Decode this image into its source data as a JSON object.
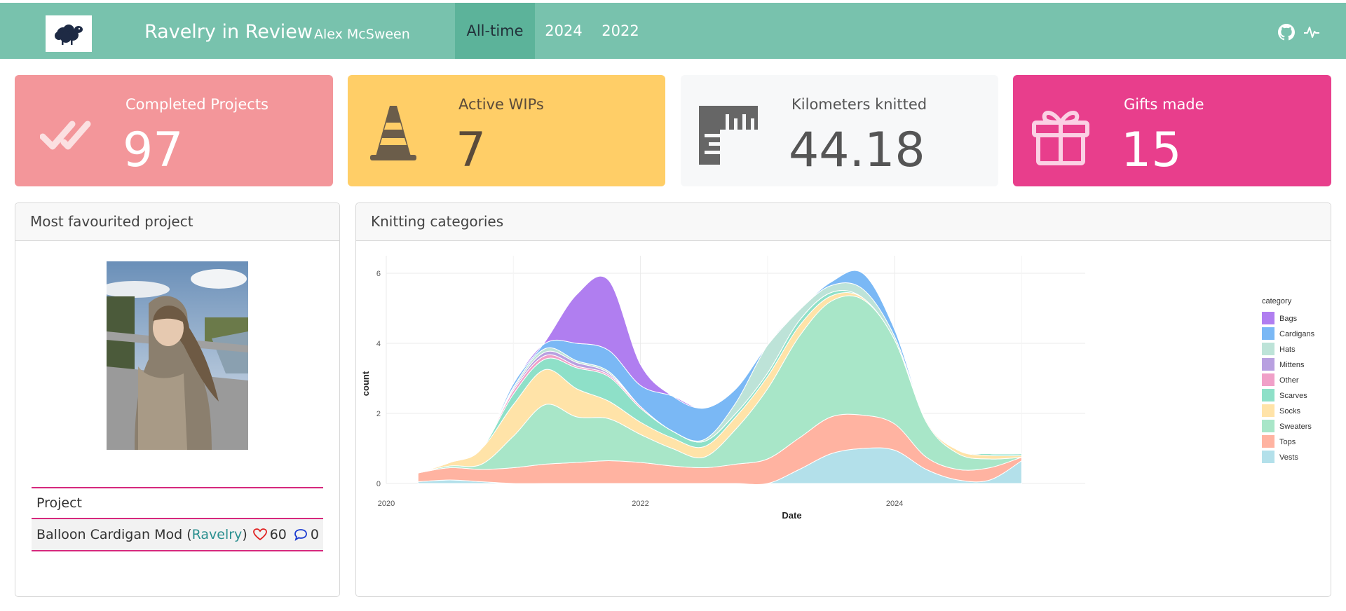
{
  "nav": {
    "title": "Ravelry in Review",
    "subtitle": "Alex McSween",
    "tabs": [
      {
        "label": "All-time",
        "active": true
      },
      {
        "label": "2024",
        "active": false
      },
      {
        "label": "2022",
        "active": false
      }
    ],
    "icons": [
      "github-icon",
      "pulse-icon"
    ],
    "color": "#78c2ad"
  },
  "stats": [
    {
      "label": "Completed Projects",
      "value": "97",
      "icon": "double-check-icon",
      "color": "#f3969a"
    },
    {
      "label": "Active WIPs",
      "value": "7",
      "icon": "traffic-cone-icon",
      "color": "#ffce67"
    },
    {
      "label": "Kilometers knitted",
      "value": "44.18",
      "icon": "ruler-icon",
      "color": "#f8f9fa"
    },
    {
      "label": "Gifts made",
      "value": "15",
      "icon": "gift-icon",
      "color": "#e83e8c"
    }
  ],
  "favourite": {
    "header": "Most favourited project",
    "table_header": "Project",
    "project_name": "Balloon Cardigan Mod",
    "link_text": "Ravelry",
    "likes": "60",
    "comments": "0"
  },
  "categories_panel": {
    "header": "Knitting categories"
  },
  "chart_data": {
    "type": "area",
    "xlabel": "Date",
    "ylabel": "count",
    "x_ticks": [
      "2020",
      "2022",
      "2024"
    ],
    "y_ticks": [
      "0",
      "2",
      "4",
      "6"
    ],
    "ylim": [
      0,
      6.5
    ],
    "legend_title": "category",
    "legend_position": "right",
    "x": [
      "2020-04",
      "2020-07",
      "2020-10",
      "2021-01",
      "2021-04",
      "2021-07",
      "2021-10",
      "2022-01",
      "2022-04",
      "2022-07",
      "2022-10",
      "2023-01",
      "2023-04",
      "2023-07",
      "2023-10",
      "2024-01",
      "2024-04",
      "2024-07",
      "2024-10",
      "2025-01"
    ],
    "series": [
      {
        "name": "Vests",
        "color": "#b3e0ea",
        "values": [
          0.05,
          0.1,
          0.05,
          0.0,
          0.0,
          0.0,
          0.0,
          0.0,
          0.0,
          0.0,
          0.0,
          0.0,
          0.4,
          0.85,
          1.0,
          0.95,
          0.4,
          0.1,
          0.1,
          0.65
        ]
      },
      {
        "name": "Tops",
        "color": "#ffb3a1",
        "values": [
          0.25,
          0.35,
          0.35,
          0.45,
          0.55,
          0.6,
          0.65,
          0.6,
          0.5,
          0.45,
          0.55,
          0.7,
          0.9,
          1.05,
          0.95,
          0.75,
          0.35,
          0.3,
          0.35,
          0.1
        ]
      },
      {
        "name": "Sweaters",
        "color": "#a8e6c8",
        "values": [
          0.0,
          0.05,
          0.15,
          0.9,
          1.7,
          1.3,
          1.2,
          0.8,
          0.5,
          0.3,
          1.0,
          2.0,
          2.9,
          3.3,
          3.3,
          2.4,
          1.0,
          0.45,
          0.25,
          0.0
        ]
      },
      {
        "name": "Socks",
        "color": "#ffe3a8",
        "values": [
          0.0,
          0.1,
          0.45,
          0.9,
          1.0,
          0.8,
          0.5,
          0.35,
          0.3,
          0.3,
          0.35,
          0.35,
          0.3,
          0.15,
          0.05,
          0.0,
          0.05,
          0.1,
          0.1,
          0.05
        ]
      },
      {
        "name": "Scarves",
        "color": "#8ee0c8",
        "values": [
          0.0,
          0.0,
          0.0,
          0.3,
          0.3,
          0.6,
          0.7,
          0.4,
          0.2,
          0.15,
          0.1,
          0.1,
          0.15,
          0.1,
          0.0,
          0.0,
          0.0,
          0.0,
          0.05,
          0.05
        ]
      },
      {
        "name": "Other",
        "color": "#f0a0c8",
        "values": [
          0.0,
          0.0,
          0.0,
          0.1,
          0.1,
          0.05,
          0.05,
          0.05,
          0.0,
          0.0,
          0.0,
          0.0,
          0.0,
          0.0,
          0.0,
          0.0,
          0.0,
          0.0,
          0.0,
          0.0
        ]
      },
      {
        "name": "Mittens",
        "color": "#b8a0e0",
        "values": [
          0.0,
          0.0,
          0.0,
          0.05,
          0.1,
          0.1,
          0.05,
          0.0,
          0.0,
          0.0,
          0.0,
          0.0,
          0.0,
          0.0,
          0.0,
          0.0,
          0.0,
          0.0,
          0.0,
          0.0
        ]
      },
      {
        "name": "Hats",
        "color": "#bde3d8",
        "values": [
          0.0,
          0.0,
          0.0,
          0.05,
          0.1,
          0.05,
          0.05,
          0.0,
          0.0,
          0.05,
          0.3,
          0.8,
          0.3,
          0.2,
          0.25,
          0.1,
          0.0,
          0.0,
          0.0,
          0.0
        ]
      },
      {
        "name": "Cardigans",
        "color": "#7ab8f5",
        "values": [
          0.0,
          0.0,
          0.0,
          0.1,
          0.15,
          0.5,
          0.6,
          0.6,
          1.0,
          0.9,
          0.4,
          0.0,
          0.0,
          0.1,
          0.45,
          0.2,
          0.0,
          0.0,
          0.0,
          0.0
        ]
      },
      {
        "name": "Bags",
        "color": "#b07ef0",
        "values": [
          0.0,
          0.0,
          0.0,
          0.0,
          0.05,
          1.4,
          2.0,
          0.6,
          0.0,
          0.0,
          0.0,
          0.0,
          0.0,
          0.0,
          0.0,
          0.0,
          0.0,
          0.0,
          0.0,
          0.0
        ]
      }
    ],
    "legend_order": [
      "Bags",
      "Cardigans",
      "Hats",
      "Mittens",
      "Other",
      "Scarves",
      "Socks",
      "Sweaters",
      "Tops",
      "Vests"
    ]
  }
}
